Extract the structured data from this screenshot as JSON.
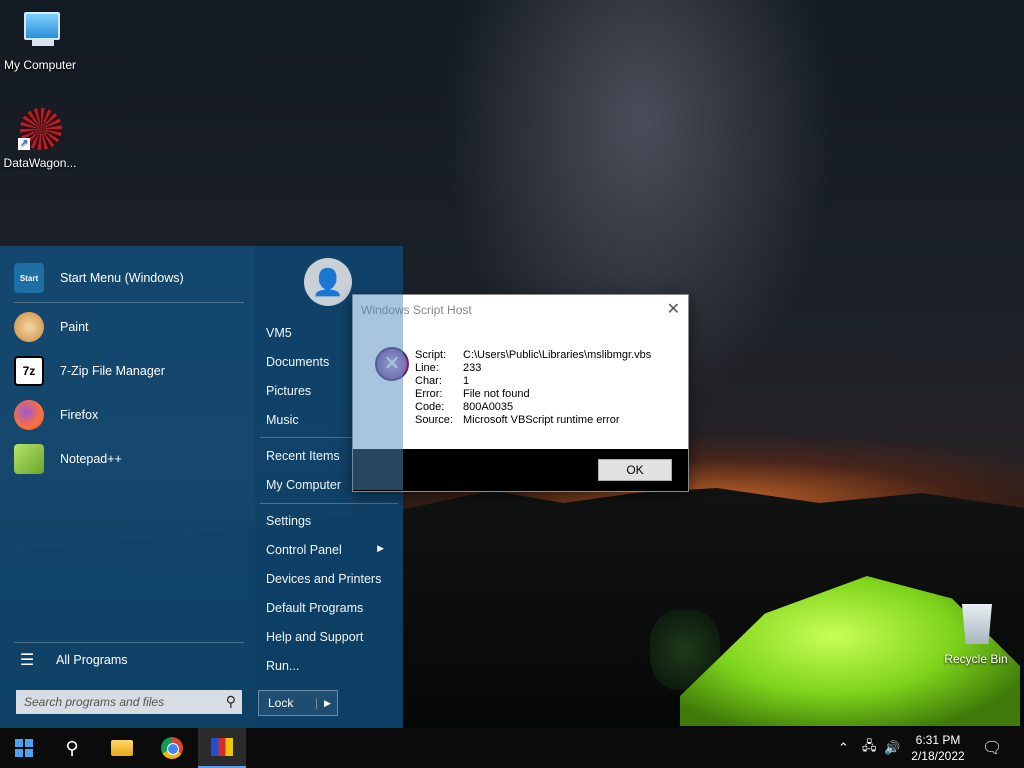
{
  "desktop": {
    "icons": [
      {
        "label": "My Computer"
      },
      {
        "label": "DataWagon..."
      },
      {
        "label": "Recycle Bin"
      }
    ]
  },
  "start_menu": {
    "pinned": [
      {
        "label": "Start Menu (Windows)",
        "icon": "start-menu-icon"
      },
      {
        "label": "Paint",
        "icon": "paint-icon"
      },
      {
        "label": "7-Zip File Manager",
        "icon": "7zip-icon",
        "icon_text": "7z"
      },
      {
        "label": "Firefox",
        "icon": "firefox-icon"
      },
      {
        "label": "Notepad++",
        "icon": "notepadpp-icon"
      }
    ],
    "start_icon_text": "Start",
    "all_programs": "All Programs",
    "search_placeholder": "Search programs and files",
    "right_items": [
      {
        "label": "VM5"
      },
      {
        "label": "Documents"
      },
      {
        "label": "Pictures"
      },
      {
        "label": "Music"
      },
      {
        "label": "Recent Items",
        "submenu": true
      },
      {
        "label": "My Computer"
      },
      {
        "label": "Settings"
      },
      {
        "label": "Control Panel",
        "submenu": true
      },
      {
        "label": "Devices and Printers"
      },
      {
        "label": "Default Programs"
      },
      {
        "label": "Help and Support"
      },
      {
        "label": "Run..."
      }
    ],
    "lock_label": "Lock"
  },
  "dialog": {
    "title": "Windows Script Host",
    "rows": [
      {
        "k": "Script:",
        "v": "C:\\Users\\Public\\Libraries\\mslibmgr.vbs"
      },
      {
        "k": "Line:",
        "v": "233"
      },
      {
        "k": "Char:",
        "v": "1"
      },
      {
        "k": "Error:",
        "v": "File not found"
      },
      {
        "k": "Code:",
        "v": "800A0035"
      },
      {
        "k": "Source:",
        "v": "Microsoft VBScript runtime error"
      }
    ],
    "ok_label": "OK"
  },
  "taskbar": {
    "time": "6:31 PM",
    "date": "2/18/2022"
  }
}
